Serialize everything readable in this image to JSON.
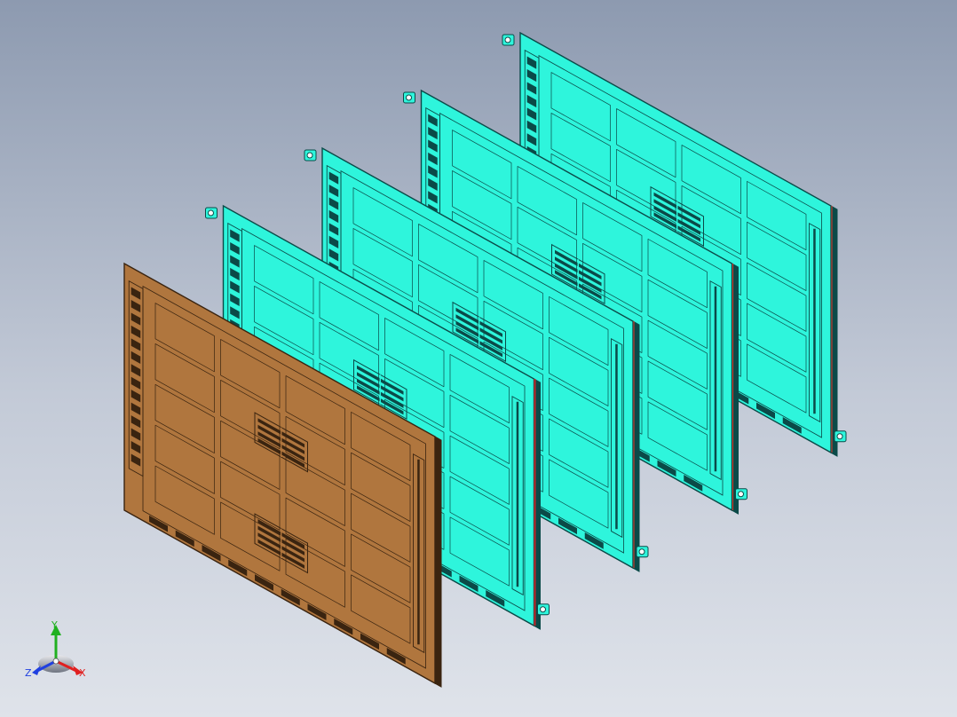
{
  "viewport": {
    "background_top": "#8d9ab0",
    "background_bottom": "#dfe3ea"
  },
  "model": {
    "plates": [
      {
        "id": "plate-5",
        "fill": "#2ef5dc",
        "edge": "#0b4a48",
        "accent": "#e03a2a"
      },
      {
        "id": "plate-4",
        "fill": "#2ef5dc",
        "edge": "#0b4a48",
        "accent": "#e03a2a"
      },
      {
        "id": "plate-3",
        "fill": "#2ef5dc",
        "edge": "#0b4a48",
        "accent": "#e03a2a"
      },
      {
        "id": "plate-2",
        "fill": "#2ef5dc",
        "edge": "#0b4a48",
        "accent": "#c0282a"
      },
      {
        "id": "plate-1",
        "fill": "#b0763e",
        "edge": "#3a2410",
        "accent": "#3a2410"
      }
    ]
  },
  "triad": {
    "x_label": "X",
    "y_label": "Y",
    "z_label": "Z",
    "x_color": "#e02020",
    "y_color": "#20b020",
    "z_color": "#2040e0"
  }
}
